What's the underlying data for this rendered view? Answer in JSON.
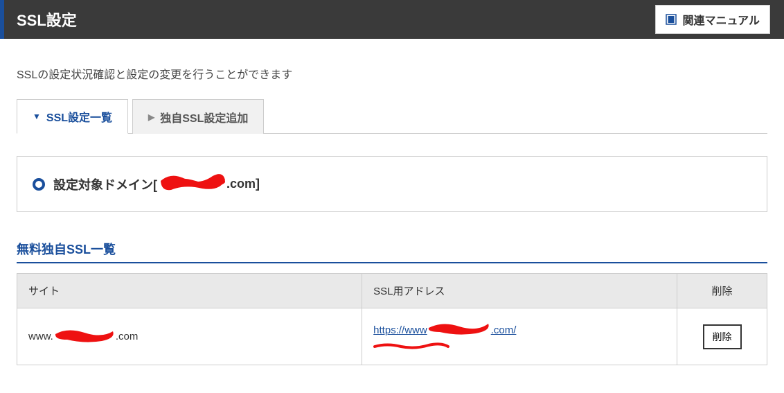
{
  "header": {
    "title": "SSL設定",
    "manual_button": "関連マニュアル"
  },
  "description": "SSLの設定状況確認と設定の変更を行うことができます",
  "tabs": {
    "list": "SSL設定一覧",
    "add": "独自SSL設定追加"
  },
  "target_domain": {
    "label_prefix": "設定対象ドメイン[",
    "domain_suffix": ".com]"
  },
  "section": {
    "free_ssl_list_title": "無料独自SSL一覧"
  },
  "table": {
    "headers": {
      "site": "サイト",
      "address": "SSL用アドレス",
      "delete": "削除"
    },
    "rows": [
      {
        "site_prefix": "www.",
        "site_suffix": ".com",
        "address_prefix": "https://www",
        "address_suffix": ".com/",
        "delete_label": "削除"
      }
    ]
  }
}
